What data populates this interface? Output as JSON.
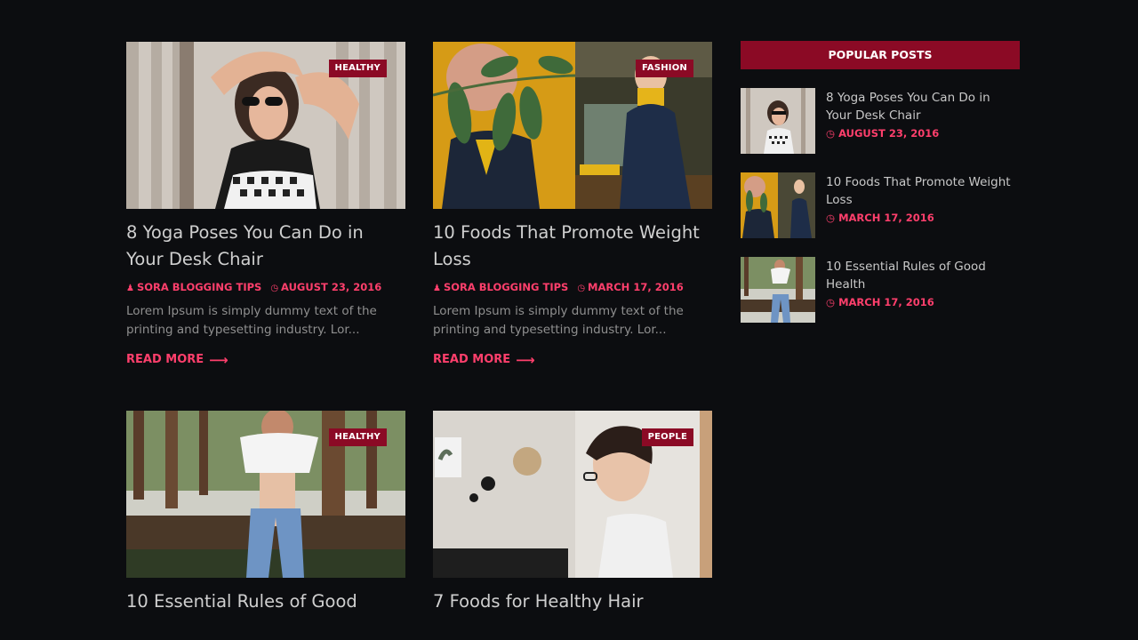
{
  "posts": [
    {
      "tag": "HEALTHY",
      "title": "8 Yoga Poses You Can Do in Your Desk Chair",
      "author": "SORA BLOGGING TIPS",
      "date": "AUGUST 23, 2016",
      "excerpt": "Lorem Ipsum is simply dummy text of the printing and typesetting industry. Lor...",
      "read_more": "READ MORE"
    },
    {
      "tag": "FASHION",
      "title": "10 Foods That Promote Weight Loss",
      "author": "SORA BLOGGING TIPS",
      "date": "MARCH 17, 2016",
      "excerpt": "Lorem Ipsum is simply dummy text of the printing and typesetting industry. Lor...",
      "read_more": "READ MORE"
    },
    {
      "tag": "HEALTHY",
      "title": "10 Essential Rules of Good"
    },
    {
      "tag": "PEOPLE",
      "title": "7 Foods for Healthy Hair"
    }
  ],
  "sidebar": {
    "widget_title": "POPULAR POSTS",
    "items": [
      {
        "title": "8 Yoga Poses You Can Do in Your Desk Chair",
        "date": "AUGUST 23, 2016"
      },
      {
        "title": "10 Foods That Promote Weight Loss",
        "date": "MARCH 17, 2016"
      },
      {
        "title": "10 Essential Rules of Good Health",
        "date": "MARCH 17, 2016"
      }
    ]
  },
  "icons": {
    "author": "user-icon",
    "date": "clock-icon",
    "read_more": "arrow-right-icon"
  },
  "colors": {
    "accent": "#ff3f6c",
    "tag_bg": "#8b0a25",
    "background": "#0c0d10"
  }
}
